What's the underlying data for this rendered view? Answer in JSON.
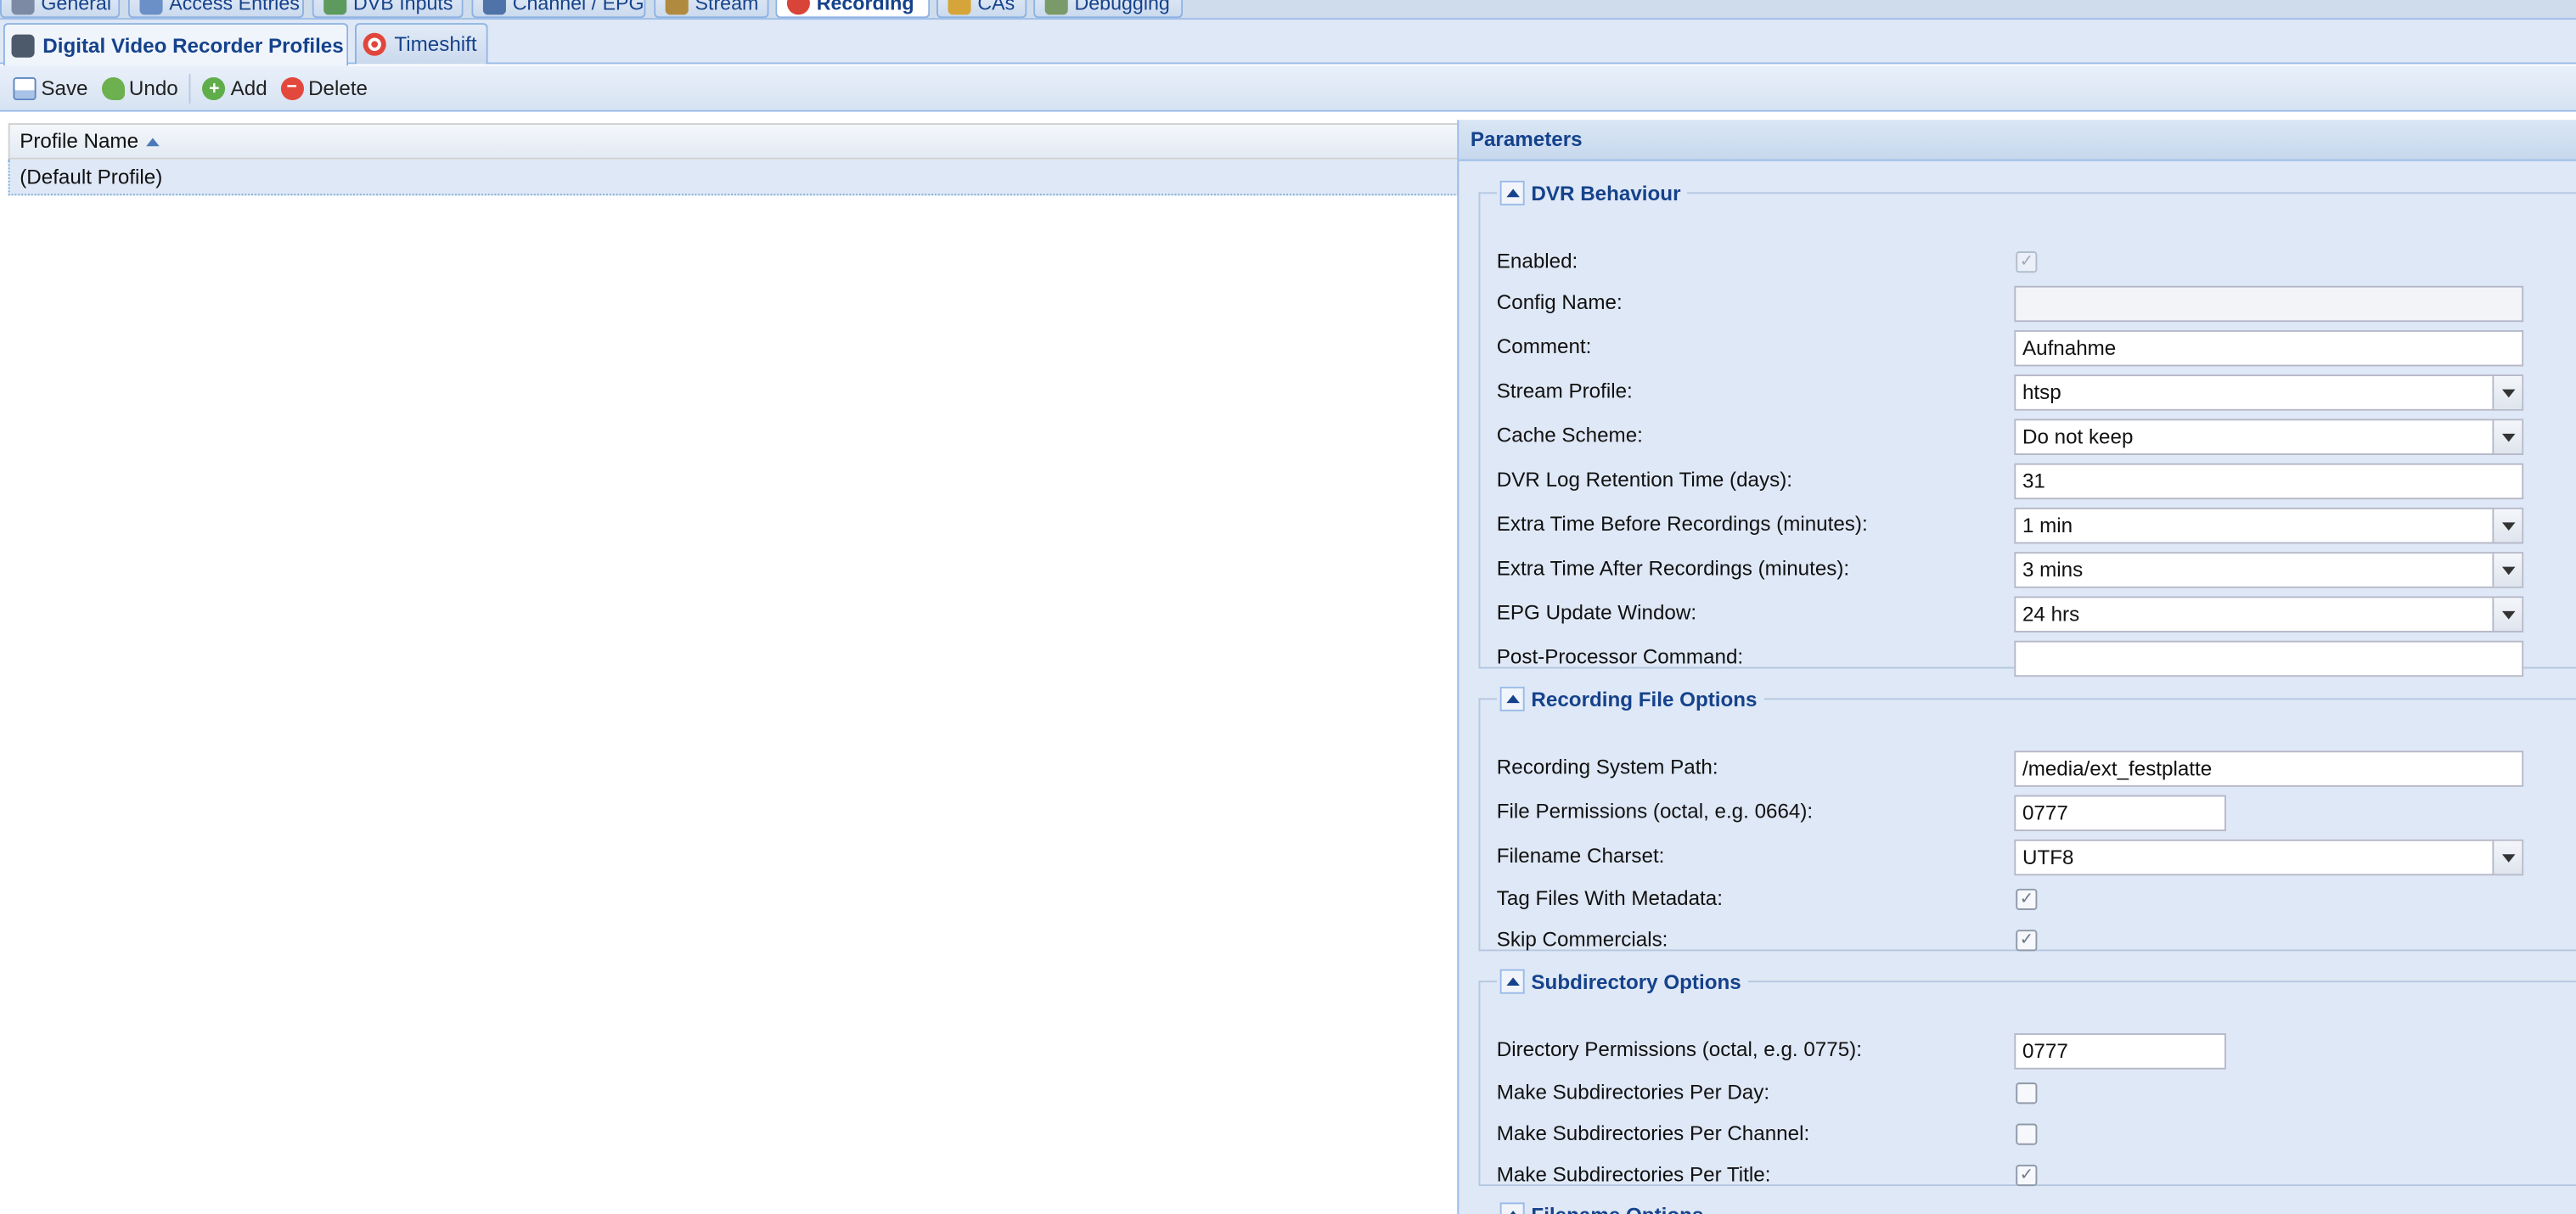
{
  "top_tabs": [
    {
      "label": "General",
      "icon": "wrench-icon"
    },
    {
      "label": "Access Entries",
      "icon": "users-icon"
    },
    {
      "label": "DVB Inputs",
      "icon": "antenna-icon"
    },
    {
      "label": "Channel / EPG",
      "icon": "tv-icon"
    },
    {
      "label": "Stream",
      "icon": "stream-icon"
    },
    {
      "label": "Recording",
      "icon": "record-icon",
      "active": true
    },
    {
      "label": "CAs",
      "icon": "key-icon"
    },
    {
      "label": "Debugging",
      "icon": "bug-icon"
    }
  ],
  "sub_tabs": [
    {
      "label": "Digital Video Recorder Profiles",
      "icon": "video-recorder-icon",
      "active": true
    },
    {
      "label": "Timeshift",
      "icon": "timeshift-icon"
    }
  ],
  "toolbar": {
    "save": "Save",
    "undo": "Undo",
    "add": "Add",
    "delete": "Delete"
  },
  "grid": {
    "column": "Profile Name",
    "rows": [
      "(Default Profile)"
    ]
  },
  "params": {
    "title": "Parameters",
    "dvr": {
      "legend": "DVR Behaviour",
      "enabled_label": "Enabled:",
      "enabled": true,
      "config_name_label": "Config Name:",
      "config_name": "",
      "comment_label": "Comment:",
      "comment": "Aufnahme",
      "stream_profile_label": "Stream Profile:",
      "stream_profile": "htsp",
      "cache_label": "Cache Scheme:",
      "cache": "Do not keep",
      "retention_label": "DVR Log Retention Time (days):",
      "retention": "31",
      "before_label": "Extra Time Before Recordings (minutes):",
      "before": "1 min",
      "after_label": "Extra Time After Recordings (minutes):",
      "after": "3 mins",
      "epg_label": "EPG Update Window:",
      "epg": "24 hrs",
      "post_label": "Post-Processor Command:",
      "post": ""
    },
    "file": {
      "legend": "Recording File Options",
      "path_label": "Recording System Path:",
      "path": "/media/ext_festplatte",
      "perm_label": "File Permissions (octal, e.g. 0664):",
      "perm": "0777",
      "charset_label": "Filename Charset:",
      "charset": "UTF8",
      "tag_label": "Tag Files With Metadata:",
      "tag": true,
      "skip_label": "Skip Commercials:",
      "skip": true
    },
    "subdir": {
      "legend": "Subdirectory Options",
      "perm_label": "Directory Permissions (octal, e.g. 0775):",
      "perm": "0777",
      "day_label": "Make Subdirectories Per Day:",
      "day": false,
      "channel_label": "Make Subdirectories Per Channel:",
      "channel": false,
      "title_label": "Make Subdirectories Per Title:",
      "title": true
    },
    "filename": {
      "legend": "Filename Options"
    }
  }
}
